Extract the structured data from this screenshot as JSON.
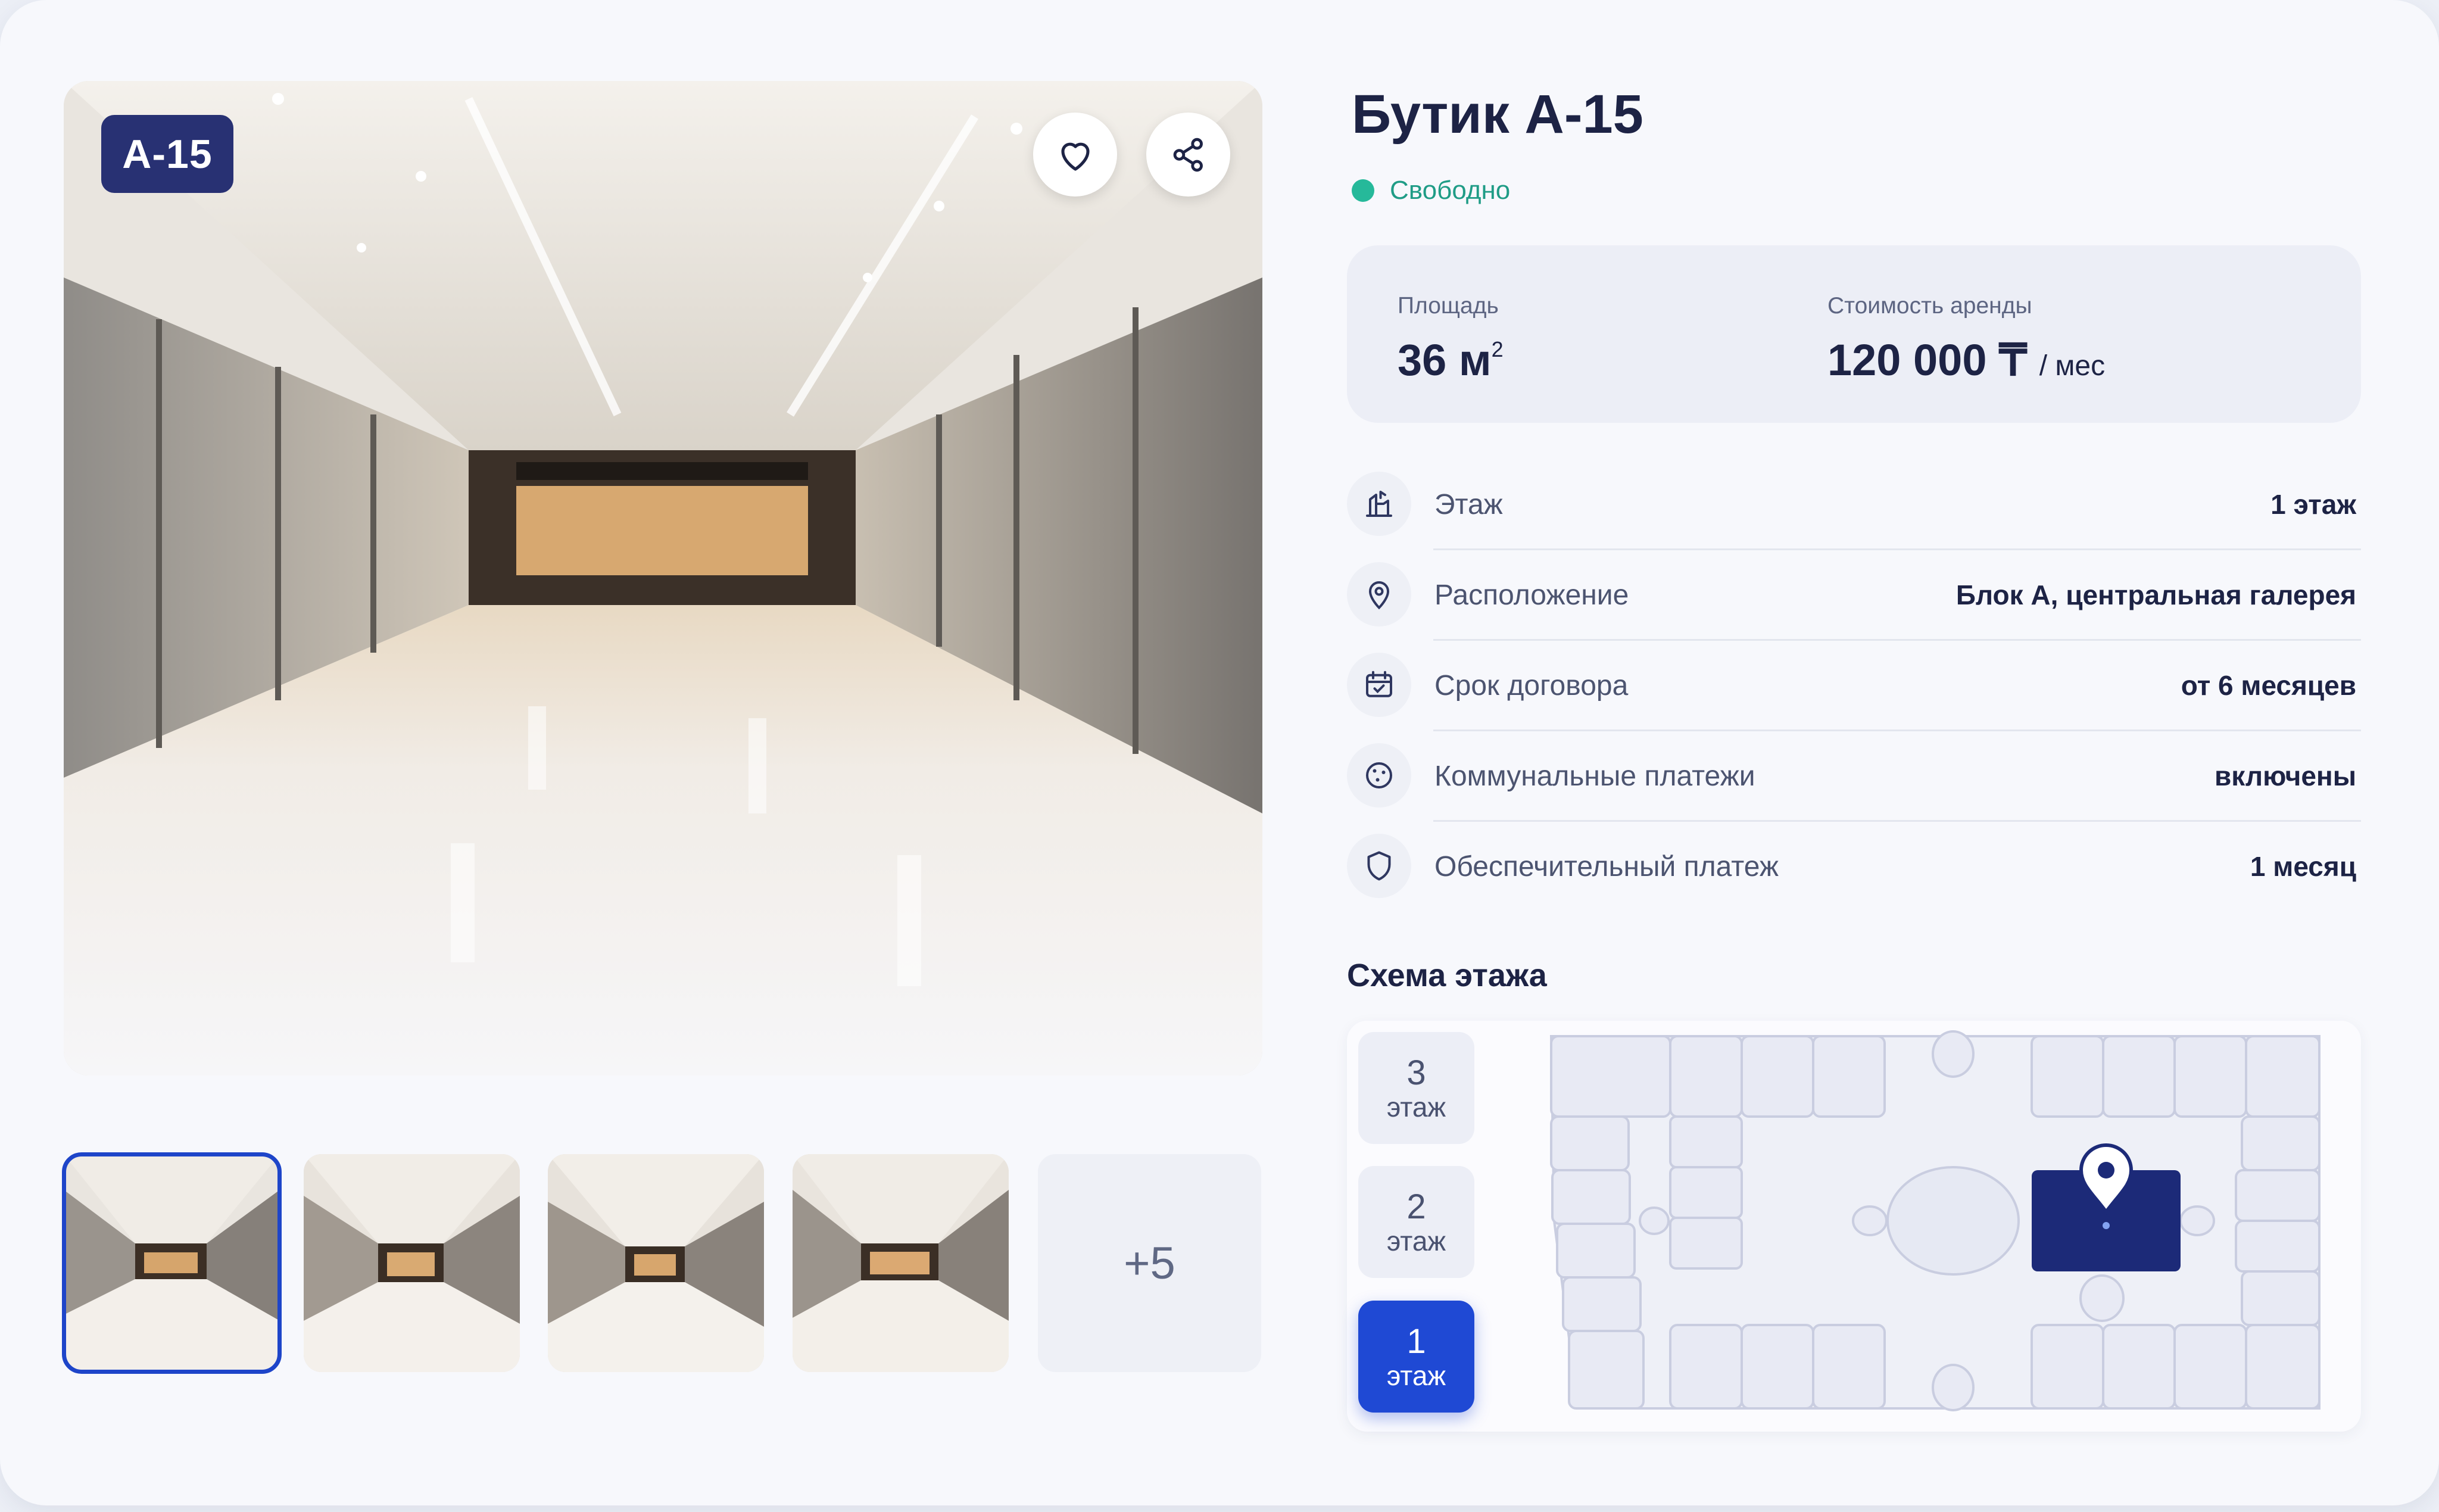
{
  "gallery": {
    "tag": "А-15",
    "favorite_icon": "heart-icon",
    "share_icon": "share-icon",
    "more_label": "+5"
  },
  "listing": {
    "title": "Бутик А-15",
    "status": "Свободно",
    "status_color": "#26b99a"
  },
  "stats": {
    "area_label": "Площадь",
    "area_value": "36 м",
    "area_unit_sup": "2",
    "price_label": "Стоимость аренды",
    "price_value": "120 000 ₸",
    "price_period": "/ мес"
  },
  "details": [
    {
      "icon": "floor-icon",
      "label": "Этаж",
      "value": "1 этаж"
    },
    {
      "icon": "location-pin-icon",
      "label": "Расположение",
      "value": "Блок А, центральная галерея"
    },
    {
      "icon": "calendar-icon",
      "label": "Срок договора",
      "value": "от 6 месяцев"
    },
    {
      "icon": "utilities-icon",
      "label": "Коммунальные платежи",
      "value": "включены"
    },
    {
      "icon": "shield-icon",
      "label": "Обеспечительный платеж",
      "value": "1 месяц"
    }
  ],
  "scheme": {
    "title": "Схема этажа",
    "floors": [
      {
        "number": "3",
        "label": "этаж"
      },
      {
        "number": "2",
        "label": "этаж"
      },
      {
        "number": "1",
        "label": "этаж"
      }
    ],
    "active_floor": "1",
    "accent_color": "#1f49d4"
  }
}
